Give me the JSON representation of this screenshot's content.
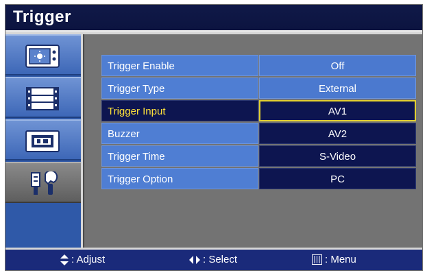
{
  "title": "Trigger",
  "sidebar": {
    "items": [
      {
        "icon": "picture-settings-icon"
      },
      {
        "icon": "film-settings-icon"
      },
      {
        "icon": "screen-settings-icon"
      },
      {
        "icon": "tools-settings-icon",
        "active": true
      }
    ]
  },
  "menu": {
    "rows": [
      {
        "label": "Trigger Enable",
        "value": "Off"
      },
      {
        "label": "Trigger Type",
        "value": "External"
      },
      {
        "label": "Trigger Input",
        "value": "AV1"
      },
      {
        "label": "Buzzer",
        "value": "AV2"
      },
      {
        "label": "Trigger Time",
        "value": "S-Video"
      },
      {
        "label": "Trigger Option",
        "value": "PC"
      }
    ]
  },
  "footer": {
    "adjust": ": Adjust",
    "select": ": Select",
    "menu": ": Menu"
  },
  "colors": {
    "title_bg": "#101948",
    "selected_text": "#ffe23a",
    "selected_border": "#e2d030",
    "row_blue": "#4f7ed3",
    "row_dark": "#0d1550"
  }
}
